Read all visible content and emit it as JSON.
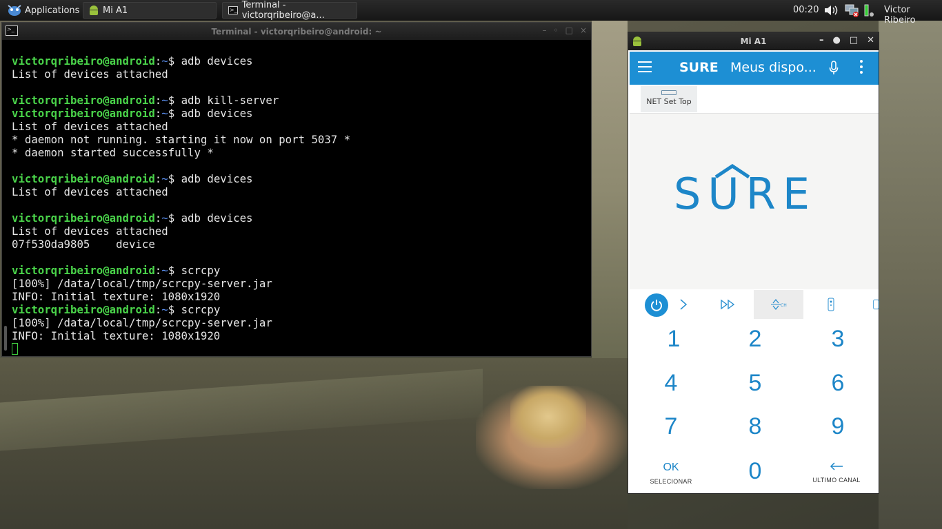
{
  "panel": {
    "applications_label": "Applications",
    "tasks": [
      {
        "label": "Mi A1"
      },
      {
        "label": "Terminal - victorqribeiro@a..."
      }
    ],
    "clock": "00:20",
    "user": "Victor Ribeiro"
  },
  "terminal": {
    "title": "Terminal - victorqribeiro@android: ~",
    "prompt_user": "victorqribeiro@android",
    "prompt_sep": ":",
    "prompt_dir": "~",
    "prompt_sym": "$ ",
    "lines": [
      {
        "cmd": "adb devices"
      },
      {
        "out": "List of devices attached"
      },
      {
        "out": ""
      },
      {
        "cmd": "adb kill-server"
      },
      {
        "cmd": "adb devices"
      },
      {
        "out": "List of devices attached"
      },
      {
        "out": "* daemon not running. starting it now on port 5037 *"
      },
      {
        "out": "* daemon started successfully *"
      },
      {
        "out": ""
      },
      {
        "cmd": "adb devices"
      },
      {
        "out": "List of devices attached"
      },
      {
        "out": ""
      },
      {
        "cmd": "adb devices"
      },
      {
        "out": "List of devices attached"
      },
      {
        "out": "07f530da9805    device"
      },
      {
        "out": ""
      },
      {
        "cmd": "scrcpy"
      },
      {
        "out": "[100%] /data/local/tmp/scrcpy-server.jar"
      },
      {
        "out": "INFO: Initial texture: 1080x1920"
      },
      {
        "cmd": "scrcpy"
      },
      {
        "out": "[100%] /data/local/tmp/scrcpy-server.jar"
      },
      {
        "out": "INFO: Initial texture: 1080x1920"
      }
    ]
  },
  "phone": {
    "window_title": "Mi A1",
    "brand": "SURE",
    "subtitle": "Meus dispo...",
    "device_tab": "NET Set Top",
    "logo_text": "SURE",
    "keys": [
      "1",
      "2",
      "3",
      "4",
      "5",
      "6",
      "7",
      "8",
      "9"
    ],
    "ok_label": "OK",
    "ok_sublabel": "SELECIONAR",
    "zero": "0",
    "last_sublabel": "ULTIMO CANAL",
    "accent_color": "#1d8fd4"
  }
}
